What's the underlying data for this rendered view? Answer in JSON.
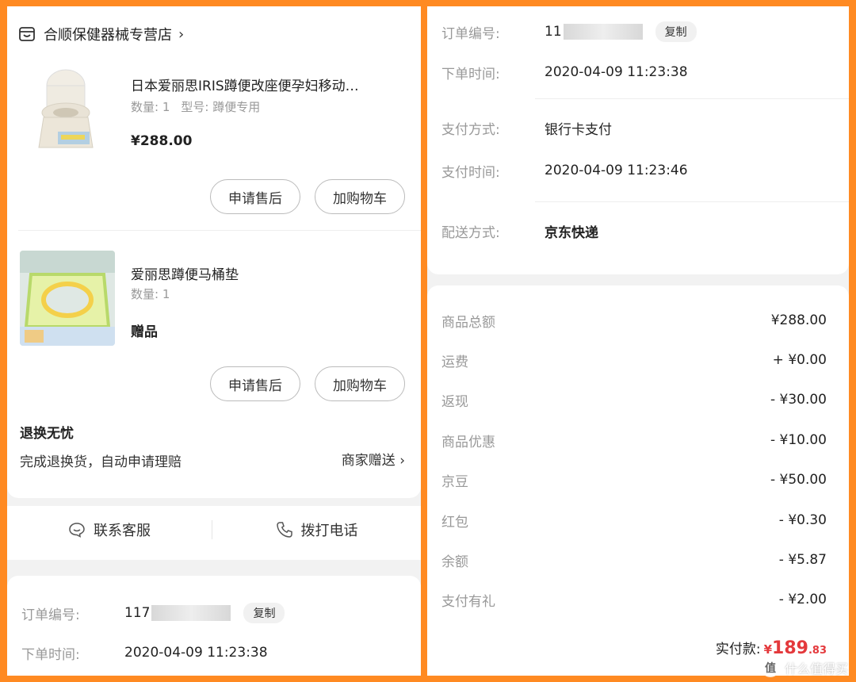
{
  "store": {
    "name": "合顺保健器械专营店",
    "chevron": "›",
    "icon": "store-icon"
  },
  "items": [
    {
      "title": "日本爱丽思IRIS蹲便改座便孕妇移动…",
      "qty_label": "数量: 1",
      "model_label": "型号: 蹲便专用",
      "price": "¥288.00",
      "buttons": [
        "申请售后",
        "加购物车"
      ]
    },
    {
      "title": "爱丽思蹲便马桶垫",
      "qty_label": "数量: 1",
      "price": "赠品",
      "buttons": [
        "申请售后",
        "加购物车"
      ]
    }
  ],
  "guarantee": {
    "title": "退换无忧",
    "desc": "完成退换货，自动申请理赔",
    "link": "商家赠送 ›"
  },
  "contact": {
    "service": "联系客服",
    "phone": "拨打电话"
  },
  "left_order": {
    "order_no_label": "订单编号:",
    "order_no_prefix": "117",
    "copy_label": "复制",
    "time_label": "下单时间:",
    "time_value": "2020-04-09 11:23:38"
  },
  "right_order": {
    "order_no_label": "订单编号:",
    "order_no_prefix": "11",
    "copy_label": "复制",
    "time_label": "下单时间:",
    "time_value": "2020-04-09 11:23:38",
    "pay_method_label": "支付方式:",
    "pay_method_value": "银行卡支付",
    "pay_time_label": "支付时间:",
    "pay_time_value": "2020-04-09 11:23:46",
    "delivery_label": "配送方式:",
    "delivery_value": "京东快递"
  },
  "fees": [
    {
      "label": "商品总额",
      "value": "¥288.00"
    },
    {
      "label": "运费",
      "value": "+ ¥0.00"
    },
    {
      "label": "返现",
      "value": "- ¥30.00"
    },
    {
      "label": "商品优惠",
      "value": "- ¥10.00"
    },
    {
      "label": "京豆",
      "value": "- ¥50.00"
    },
    {
      "label": "红包",
      "value": "- ¥0.30"
    },
    {
      "label": "余额",
      "value": "- ¥5.87"
    },
    {
      "label": "支付有礼",
      "value": "- ¥2.00"
    }
  ],
  "total": {
    "label": "实付款:",
    "currency": "¥",
    "amount": "189",
    "decimals": ".83"
  },
  "watermark": {
    "text": "什么值得买",
    "logo_text": "值"
  },
  "colors": {
    "frame": "#ff8a22",
    "price_red": "#e4393c"
  }
}
